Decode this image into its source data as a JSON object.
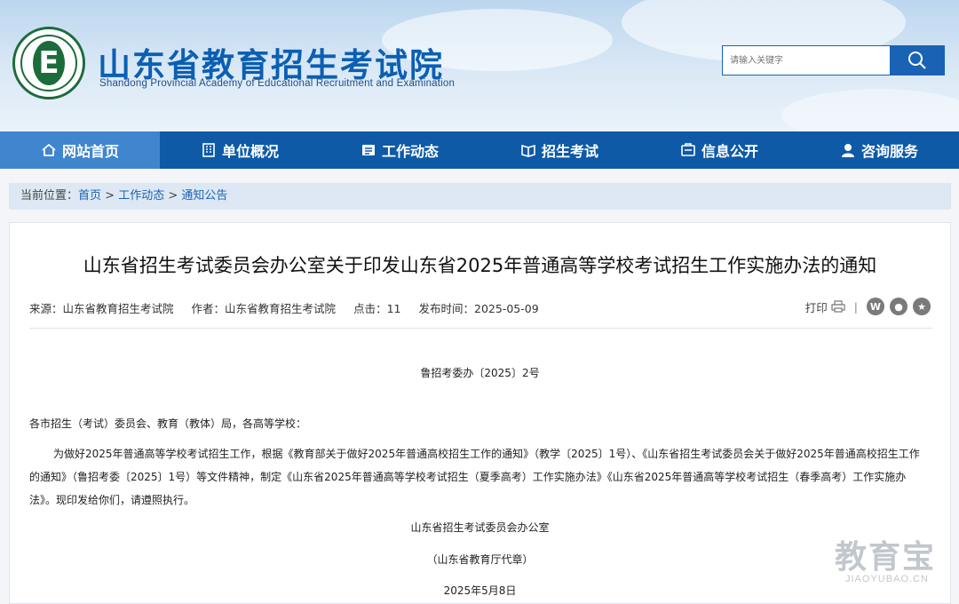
{
  "header": {
    "site_title": "山东省教育招生考试院",
    "site_subtitle": "Shandong Provincial Academy of Educational Recruitment and Examination",
    "logo_letter": "E",
    "search_placeholder": "请输入关键字"
  },
  "nav": {
    "items": [
      {
        "label": "网站首页",
        "icon": "home-icon",
        "active": true
      },
      {
        "label": "单位概况",
        "icon": "building-icon",
        "active": false
      },
      {
        "label": "工作动态",
        "icon": "news-icon",
        "active": false
      },
      {
        "label": "招生考试",
        "icon": "book-icon",
        "active": false
      },
      {
        "label": "信息公开",
        "icon": "info-icon",
        "active": false
      },
      {
        "label": "咨询服务",
        "icon": "user-service-icon",
        "active": false
      }
    ]
  },
  "breadcrumb": {
    "prefix": "当前位置：",
    "items": [
      "首页",
      "工作动态",
      "通知公告"
    ],
    "separator": " > "
  },
  "article": {
    "title": "山东省招生考试委员会办公室关于印发山东省2025年普通高等学校考试招生工作实施办法的通知",
    "meta": {
      "source_label": "来源：",
      "source": "山东省教育招生考试院",
      "author_label": "作者：",
      "author": "山东省教育招生考试院",
      "clicks_label": "点击：",
      "clicks": "11",
      "date_label": "发布时间：",
      "date": "2025-05-09"
    },
    "print_label": "打印",
    "share_icons": [
      "weibo-icon",
      "wechat-icon",
      "favorite-icon"
    ],
    "doc_number": "鲁招考委办〔2025〕2号",
    "salutation": "各市招生（考试）委员会、教育（教体）局，各高等学校：",
    "body": "为做好2025年普通高等学校考试招生工作，根据《教育部关于做好2025年普通高校招生工作的通知》（教学〔2025〕1号）、《山东省招生考试委员会关于做好2025年普通高校招生工作的通知》（鲁招考委〔2025〕1号）等文件精神，制定《山东省2025年普通高等学校考试招生（夏季高考）工作实施办法》《山东省2025年普通高等学校考试招生（春季高考）工作实施办法》。现印发给你们，请遵照执行。",
    "signature": "山东省招生考试委员会办公室",
    "seal_note": "（山东省教育厅代章）",
    "sign_date": "2025年5月8日"
  },
  "watermark": {
    "big": "教育宝",
    "small": "JIAOYUBAO.CN"
  },
  "colors": {
    "nav_bg": "#0e5aa7",
    "nav_active": "#3f86cf",
    "title_blue": "#0b5fb3",
    "breadcrumb_bg": "#dde8f4"
  }
}
